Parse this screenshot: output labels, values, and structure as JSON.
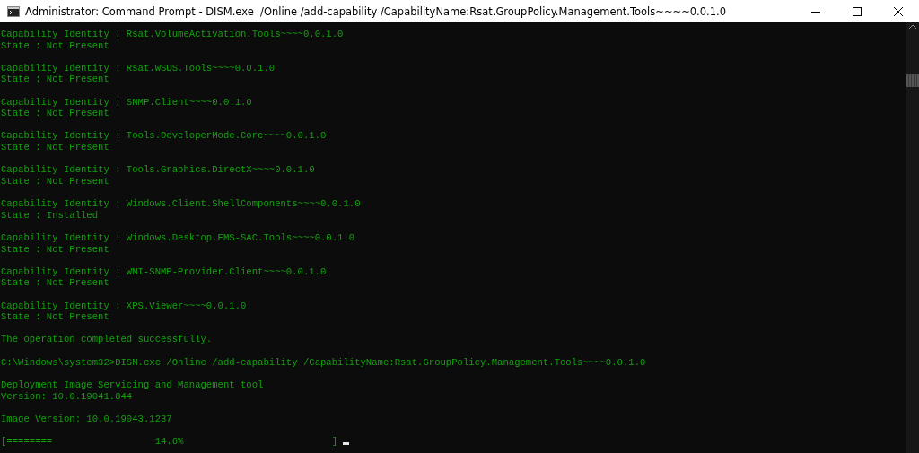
{
  "window": {
    "title": "Administrator: Command Prompt - DISM.exe  /Online /add-capability /CapabilityName:Rsat.GroupPolicy.Management.Tools~~~~0.0.1.0"
  },
  "console": {
    "blocks": [
      {
        "lines": [
          "Capability Identity : Rsat.VolumeActivation.Tools~~~~0.0.1.0",
          "State : Not Present"
        ]
      },
      {
        "lines": [
          "Capability Identity : Rsat.WSUS.Tools~~~~0.0.1.0",
          "State : Not Present"
        ]
      },
      {
        "lines": [
          "Capability Identity : SNMP.Client~~~~0.0.1.0",
          "State : Not Present"
        ]
      },
      {
        "lines": [
          "Capability Identity : Tools.DeveloperMode.Core~~~~0.0.1.0",
          "State : Not Present"
        ]
      },
      {
        "lines": [
          "Capability Identity : Tools.Graphics.DirectX~~~~0.0.1.0",
          "State : Not Present"
        ]
      },
      {
        "lines": [
          "Capability Identity : Windows.Client.ShellComponents~~~~0.0.1.0",
          "State : Installed"
        ]
      },
      {
        "lines": [
          "Capability Identity : Windows.Desktop.EMS-SAC.Tools~~~~0.0.1.0",
          "State : Not Present"
        ]
      },
      {
        "lines": [
          "Capability Identity : WMI-SNMP-Provider.Client~~~~0.0.1.0",
          "State : Not Present"
        ]
      },
      {
        "lines": [
          "Capability Identity : XPS.Viewer~~~~0.0.1.0",
          "State : Not Present"
        ]
      },
      {
        "lines": [
          "The operation completed successfully."
        ]
      },
      {
        "lines": [
          "C:\\Windows\\system32>DISM.exe /Online /add-capability /CapabilityName:Rsat.GroupPolicy.Management.Tools~~~~0.0.1.0"
        ]
      },
      {
        "lines": [
          "Deployment Image Servicing and Management tool",
          "Version: 10.0.19041.844"
        ]
      },
      {
        "lines": [
          "Image Version: 10.0.19043.1237"
        ]
      },
      {
        "lines": [
          "[========                  14.6%                          ]"
        ]
      }
    ]
  }
}
